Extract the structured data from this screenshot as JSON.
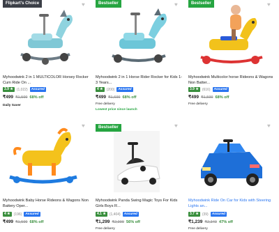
{
  "products": [
    {
      "badge": "Flipkart's Choice",
      "title": "Myhoodwink 2 in 1 MULTICOLOR Horsey Rocker Cum Ride On ...",
      "rating": "3.9 ★",
      "reviews": "(1,022)",
      "assured": "Assured",
      "price": "₹499",
      "mrp": "₹1,599",
      "off": "68% off",
      "extra1": "Daily Saver",
      "extra2": ""
    },
    {
      "badge": "Bestseller",
      "title": "Myhoodwink 2 in 1 Horse Rider Rocker for Kids 1-3 Years...",
      "rating": "4 ★",
      "reviews": "(200)",
      "assured": "Assured",
      "price": "₹499",
      "mrp": "₹1,699",
      "off": "68% off",
      "extra1": "Free delivery",
      "extra2": "Lowest price since launch"
    },
    {
      "badge": "Bestseller",
      "title": "Myhoodwink Multicolor horse Rideons & Wagons Non Batter...",
      "rating": "3.9 ★",
      "reviews": "(616)",
      "assured": "Assured",
      "price": "₹499",
      "mrp": "₹1,599",
      "off": "68% off",
      "extra1": "Free delivery",
      "extra2": ""
    },
    {
      "badge": "",
      "title": "Myhoodwink Baby Horse Rideons & Wagons Non Battery Oper...",
      "rating": "4 ★",
      "reviews": "(196)",
      "assured": "Assured",
      "price": "₹499",
      "mrp": "₹1,599",
      "off": "68% off",
      "extra1": "",
      "extra2": ""
    },
    {
      "badge": "Bestseller",
      "title": "Myhoodwink Panda Swing Magic Toys For Kids Girls Boys R...",
      "rating": "4.1 ★",
      "reviews": "(1,404)",
      "assured": "Assured",
      "price": "₹1,299",
      "mrp": "₹2,999",
      "off": "56% off",
      "extra1": "Free delivery",
      "extra2": ""
    },
    {
      "badge": "",
      "title": "Myhoodwink Ride On Car for Kids with Steering Lights an...",
      "rating": "3.7 ★",
      "reviews": "(39)",
      "assured": "Assured",
      "price": "₹1,239",
      "mrp": "₹2,349",
      "off": "47% off",
      "extra1": "Free delivery",
      "extra2": ""
    }
  ],
  "colors": {
    "rating_green": "#388e3c",
    "assured_blue": "#2874f0",
    "bestseller_green": "#26a541",
    "choice_dark": "#3b3f47"
  },
  "icons": {
    "wishlist": "heart-icon"
  }
}
